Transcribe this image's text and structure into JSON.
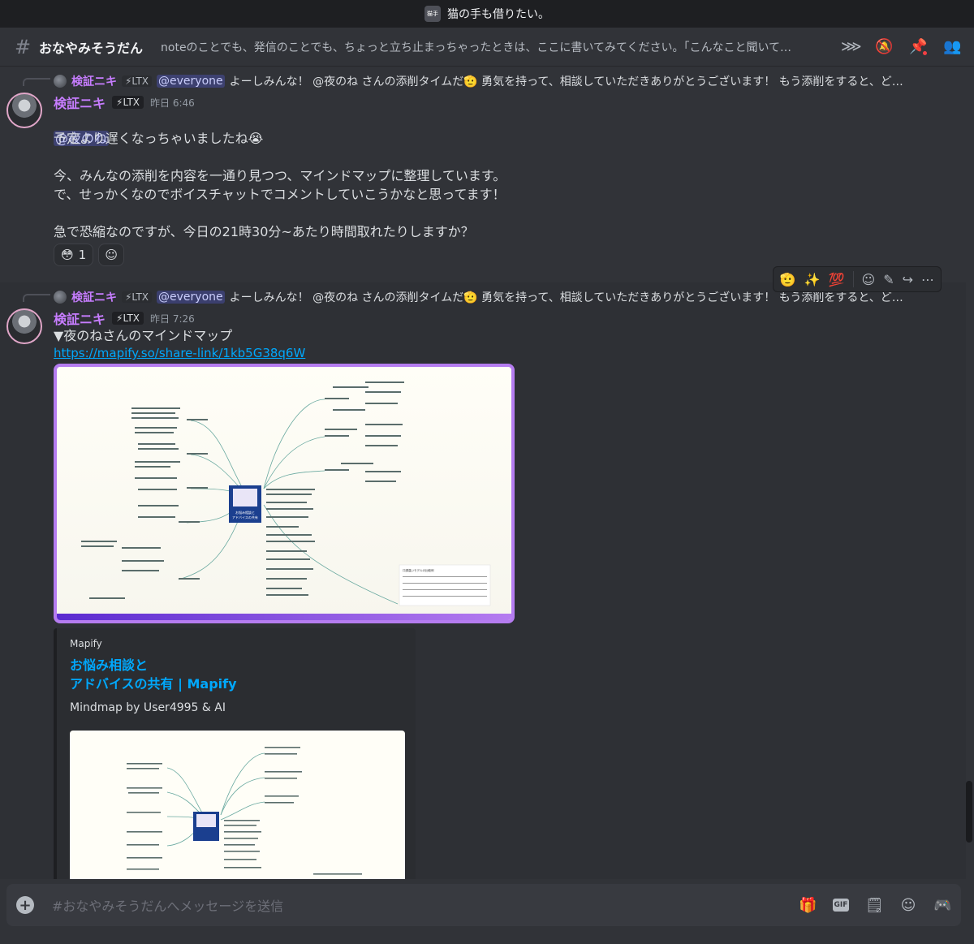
{
  "window": {
    "server_title": "猫の手も借りたい。",
    "server_icon_text": "猫手"
  },
  "channel": {
    "name": "おなやみそうだん",
    "topic": "noteのことでも、発信のことでも、ちょっと立ち止まっちゃったときは、ここに書いてみてください。「こんなこと聞いて…",
    "icons": [
      "threads-icon",
      "mute-icon",
      "pin-icon",
      "members-icon"
    ]
  },
  "messages": [
    {
      "reply": {
        "name": "検証ニキ",
        "role": "⚡LTX",
        "mention": "@everyone",
        "text": "よーしみんな！ @夜のね さんの添削タイムだ🫡 勇気を持って、相談していただきありがとうございます！ もう添削をすると、ど…"
      },
      "author": "検証ニキ",
      "role": "⚡LTX",
      "time": "昨日 6:46",
      "mention": "@夜のね",
      "body": "予定より遅くなっちゃいましたね😭\n\n今、みんなの添削を内容を一通り見つつ、マインドマップに整理しています。\nで、せっかくなのでボイスチャットでコメントしていこうかなと思ってます！\n\n急で恐縮なのですが、今日の21時30分~あたり時間取れたりしますか？",
      "reactions": [
        {
          "emoji": "😳",
          "count": "1"
        }
      ],
      "add_reaction_icon": "☺"
    },
    {
      "reply": {
        "name": "検証ニキ",
        "role": "⚡LTX",
        "mention": "@everyone",
        "text": "よーしみんな！ @夜のね さんの添削タイムだ🫡 勇気を持って、相談していただきありがとうございます！ もう添削をすると、ど…"
      },
      "author": "検証ニキ",
      "role": "⚡LTX",
      "time": "昨日 7:26",
      "body": "▼夜のねさんのマインドマップ",
      "link": "https://mapify.so/share-link/1kb5G38q6W",
      "embed": {
        "provider": "Mapify",
        "title": "お悩み相談と\nアドバイスの共有 | Mapify",
        "description": "Mindmap by User4995 & AI"
      },
      "map_center": "お悩み相談と\nアドバイスの共有",
      "map_table_title": "口調違いモデルの比較例"
    }
  ],
  "toolbar": {
    "quick_reactions": [
      "🫡",
      "✨",
      "💯"
    ]
  },
  "composer": {
    "placeholder": "#おなやみそうだんへメッセージを送信"
  },
  "colors": {
    "accent": "#c77dff",
    "link": "#00a8fc",
    "background": "#313338",
    "map_border": "#b57cf0"
  }
}
